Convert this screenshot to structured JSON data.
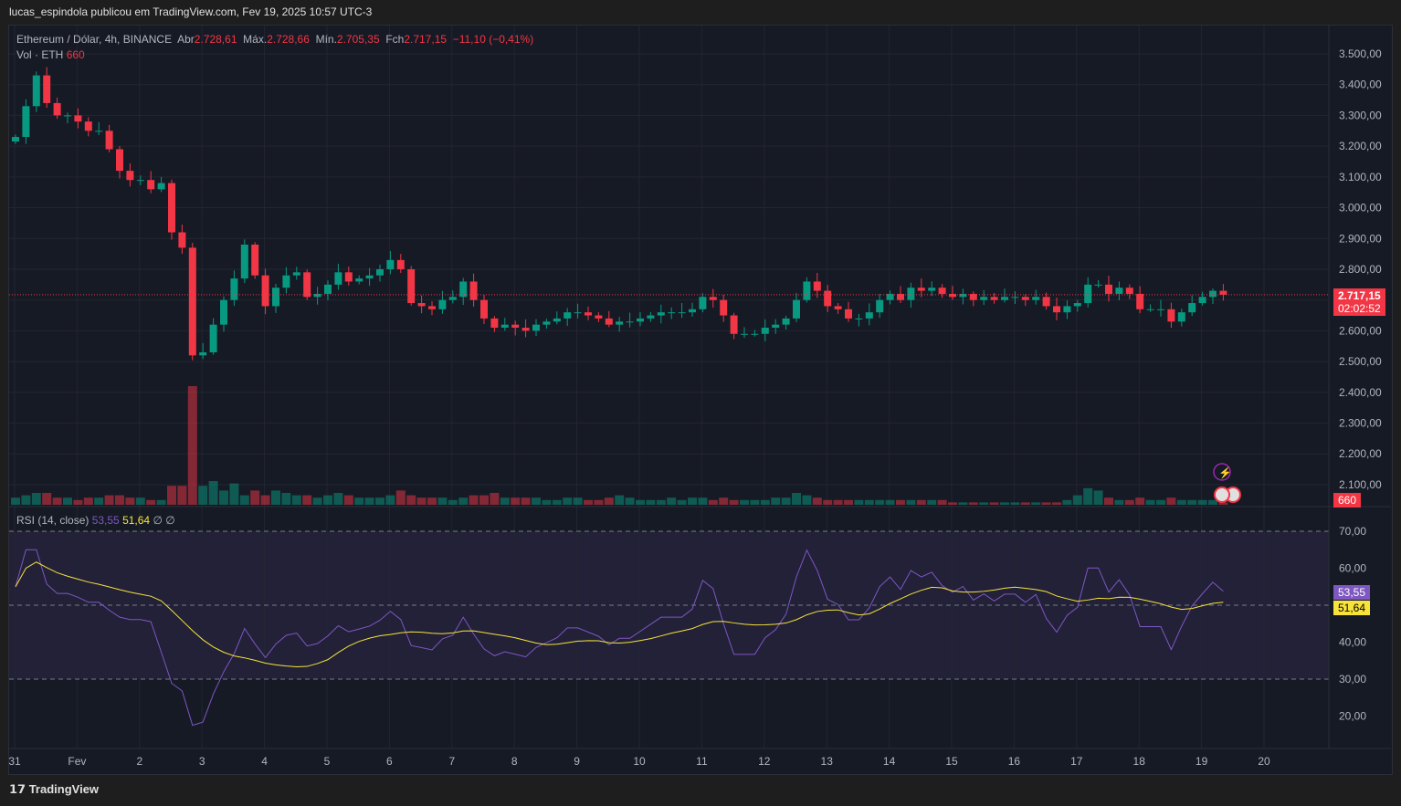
{
  "header": "lucas_espindola publicou em TradingView.com, Fev 19, 2025 10:57 UTC-3",
  "legend": {
    "symbol": "Ethereum / Dólar, 4h, BINANCE",
    "open_label": "Abr",
    "open": "2.728,61",
    "high_label": "Máx.",
    "high": "2.728,66",
    "low_label": "Mín.",
    "low": "2.705,35",
    "close_label": "Fch",
    "close": "2.717,15",
    "change": "−11,10 (−0,41%)",
    "vol_label": "Vol · ETH",
    "vol": "660"
  },
  "rsi_legend": {
    "label": "RSI (14, close)",
    "rsi": "53,55",
    "ma": "51,64",
    "x1": "∅",
    "x2": "∅"
  },
  "price_tag": {
    "price": "2.717,15",
    "countdown": "02:02:52"
  },
  "vol_tag": "660",
  "rsi_tag": "53,55",
  "rsi_ma_tag": "51,64",
  "footer": "TradingView",
  "colors": {
    "up": "#089981",
    "down": "#f23645",
    "rsi": "#7e57c2",
    "ma": "#f7e33a"
  },
  "chart_data": {
    "type": "candlestick",
    "title": "Ethereum / Dólar, 4h, BINANCE",
    "price_ticks": [
      "3.500,00",
      "3.400,00",
      "3.300,00",
      "3.200,00",
      "3.100,00",
      "3.000,00",
      "2.900,00",
      "2.800,00",
      "2.700,00",
      "2.600,00",
      "2.500,00",
      "2.400,00",
      "2.300,00",
      "2.200,00",
      "2.100,00"
    ],
    "price_tick_values": [
      3500,
      3400,
      3300,
      3200,
      3100,
      3000,
      2900,
      2800,
      2700,
      2600,
      2500,
      2400,
      2300,
      2200,
      2100
    ],
    "rsi_ticks": [
      "70,00",
      "60,00",
      "50,00",
      "40,00",
      "30,00",
      "20,00"
    ],
    "rsi_tick_values": [
      70,
      60,
      50,
      40,
      30,
      20
    ],
    "x_labels": [
      "31",
      "Fev",
      "2",
      "3",
      "4",
      "5",
      "6",
      "7",
      "8",
      "9",
      "10",
      "11",
      "12",
      "13",
      "14",
      "15",
      "16",
      "17",
      "18",
      "19",
      "20"
    ],
    "closes": [
      3230,
      3330,
      3430,
      3340,
      3300,
      3300,
      3280,
      3250,
      3250,
      3190,
      3120,
      3090,
      3090,
      3060,
      3080,
      2920,
      2870,
      2520,
      2530,
      2620,
      2700,
      2770,
      2880,
      2780,
      2680,
      2740,
      2780,
      2790,
      2710,
      2720,
      2750,
      2790,
      2760,
      2770,
      2780,
      2800,
      2830,
      2800,
      2690,
      2680,
      2670,
      2700,
      2710,
      2760,
      2700,
      2640,
      2610,
      2620,
      2610,
      2600,
      2620,
      2630,
      2640,
      2660,
      2660,
      2650,
      2640,
      2620,
      2630,
      2630,
      2640,
      2650,
      2660,
      2660,
      2660,
      2670,
      2710,
      2700,
      2650,
      2590,
      2590,
      2590,
      2610,
      2620,
      2640,
      2700,
      2760,
      2730,
      2680,
      2670,
      2640,
      2640,
      2660,
      2700,
      2720,
      2700,
      2740,
      2730,
      2740,
      2720,
      2710,
      2720,
      2700,
      2710,
      2700,
      2710,
      2710,
      2700,
      2710,
      2680,
      2660,
      2680,
      2690,
      2750,
      2750,
      2720,
      2740,
      2720,
      2670,
      2670,
      2670,
      2630,
      2660,
      2690,
      2710,
      2730,
      2717.15
    ],
    "volumes": [
      3,
      4,
      5,
      5,
      3,
      3,
      2,
      3,
      3,
      4,
      4,
      3,
      3,
      2,
      2,
      8,
      8,
      50,
      8,
      10,
      6,
      9,
      4,
      6,
      4,
      6,
      5,
      4,
      4,
      3,
      4,
      5,
      4,
      3,
      3,
      3,
      4,
      6,
      4,
      3,
      3,
      3,
      2,
      3,
      4,
      4,
      5,
      3,
      3,
      3,
      3,
      2,
      2,
      3,
      3,
      2,
      2,
      3,
      4,
      3,
      2,
      2,
      2,
      3,
      2,
      3,
      3,
      2,
      3,
      2,
      2,
      2,
      2,
      3,
      3,
      5,
      4,
      3,
      2,
      2,
      2,
      2,
      2,
      2,
      2,
      2,
      2,
      2,
      2,
      2,
      1,
      1,
      1,
      1,
      1,
      1,
      1,
      1,
      1,
      1,
      1,
      2,
      4,
      7,
      6,
      3,
      2,
      2,
      3,
      2,
      2,
      3,
      2,
      2,
      2,
      2,
      1
    ]
  }
}
